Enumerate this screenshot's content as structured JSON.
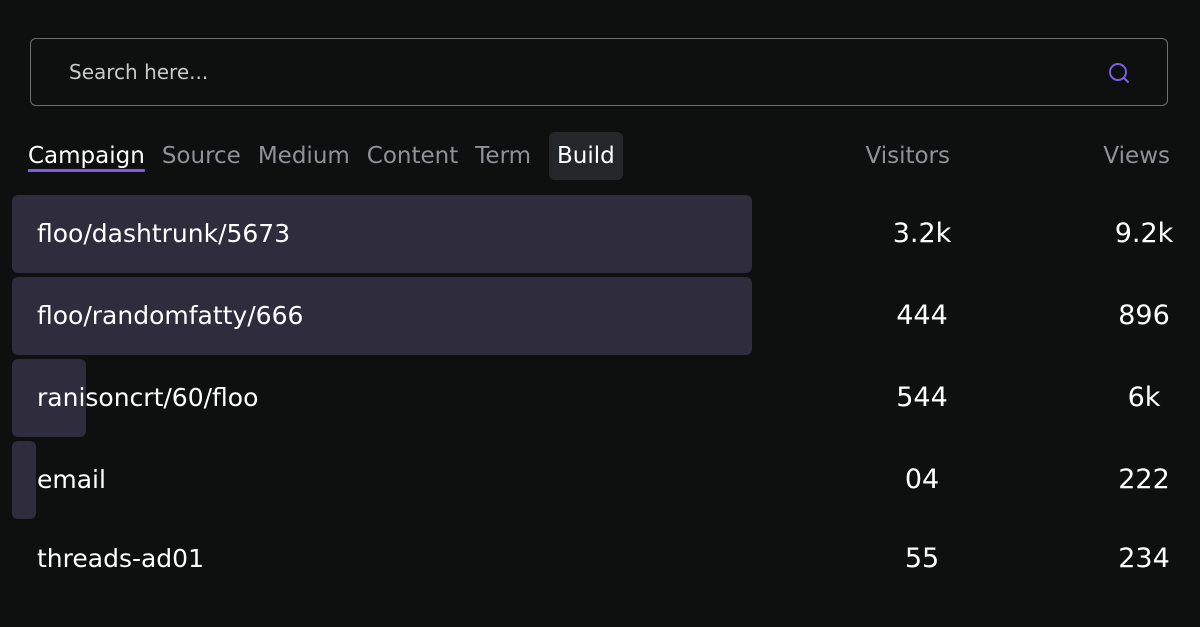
{
  "search": {
    "placeholder": "Search here...",
    "icon": "search-icon",
    "icon_color": "#7c5ce8"
  },
  "tabs": [
    {
      "label": "Campaign",
      "active": true
    },
    {
      "label": "Source"
    },
    {
      "label": "Medium"
    },
    {
      "label": "Content"
    },
    {
      "label": "Term"
    },
    {
      "label": "Build",
      "highlighted": true
    }
  ],
  "columns": {
    "visitors": "Visitors",
    "views": "Views"
  },
  "rows": [
    {
      "label": "floo/dashtrunk/5673",
      "visitors": "3.2k",
      "views": "9.2k",
      "share": 1.0
    },
    {
      "label": "floo/randomfatty/666",
      "visitors": "444",
      "views": "896",
      "share": 1.0
    },
    {
      "label": "ranisoncrt/60/floo",
      "visitors": "544",
      "views": "6k",
      "share": 0.1
    },
    {
      "label": "email",
      "visitors": "04",
      "views": "222",
      "share": 0.03
    },
    {
      "label": "threads-ad01",
      "visitors": "55",
      "views": "234",
      "share": 0
    }
  ],
  "colors": {
    "background": "#0e0f0f",
    "bar": "#2e2c3d",
    "accent": "#7c5ce8",
    "muted_text": "#8e9196"
  }
}
